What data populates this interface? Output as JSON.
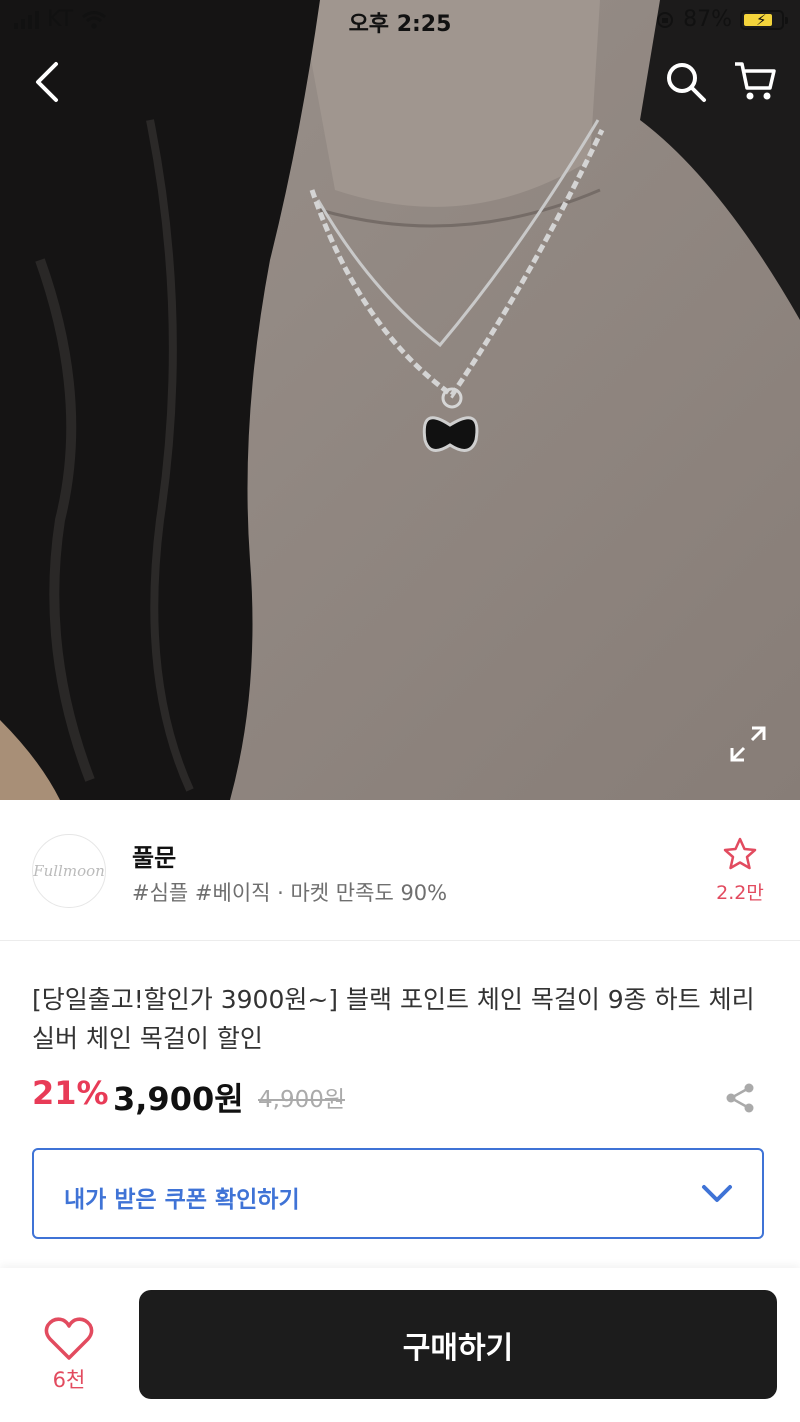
{
  "status_bar": {
    "carrier": "KT",
    "time": "오후 2:25",
    "battery": "87%"
  },
  "nav": {
    "back_icon": "chevron-left-icon",
    "search_icon": "search-icon",
    "cart_icon": "cart-icon",
    "expand_icon": "expand-icon"
  },
  "seller": {
    "logo_text": "Fullmoon",
    "name": "풀문",
    "tags": "#심플 #베이직 · 마켓 만족도 90%",
    "favorite_count": "2.2만"
  },
  "product": {
    "title": "[당일출고!할인가 3900원~] 블랙 포인트 체인 목걸이 9종 하트 체리 실버 체인 목걸이 할인",
    "discount": "21%",
    "price": "3,900원",
    "original_price": "4,900원"
  },
  "coupon": {
    "label": "내가 받은 쿠폰 확인하기"
  },
  "bottom_bar": {
    "like_count": "6천",
    "buy_label": "구매하기"
  },
  "colors": {
    "accent_red": "#e83b57",
    "coupon_blue": "#3f73d6",
    "buy_button": "#1c1c1c"
  }
}
